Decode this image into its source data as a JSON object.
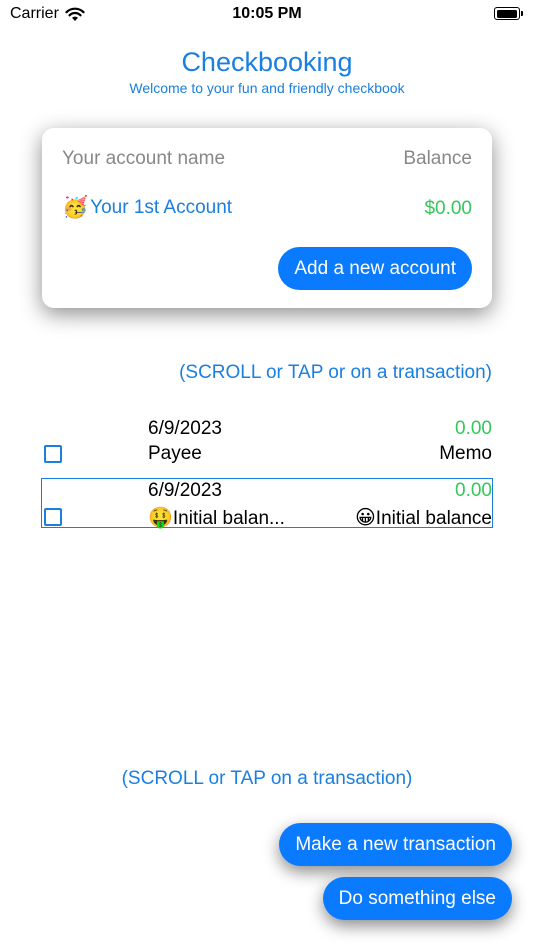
{
  "status_bar": {
    "carrier": "Carrier",
    "time": "10:05 PM",
    "wifi_icon": "wifi-icon",
    "battery_icon": "battery-full-icon"
  },
  "header": {
    "title": "Checkbooking",
    "subtitle": "Welcome to your fun and friendly checkbook"
  },
  "accounts_card": {
    "name_header": "Your account name",
    "balance_header": "Balance",
    "accounts": [
      {
        "emoji": "🥳",
        "name": "Your 1st Account",
        "balance": "$0.00"
      }
    ],
    "add_button_label": "Add a new account"
  },
  "hints": {
    "top": "(SCROLL or TAP or on a transaction)",
    "bottom": "(SCROLL or TAP on a transaction)"
  },
  "transactions": [
    {
      "date": "6/9/2023",
      "amount": "0.00",
      "payee": "Payee",
      "payee_emoji": "",
      "memo": "Memo",
      "memo_emoji": "",
      "selected": false
    },
    {
      "date": "6/9/2023",
      "amount": "0.00",
      "payee": "Initial balan...",
      "payee_emoji": "🤑",
      "memo": "Initial balance",
      "memo_emoji": "😀",
      "selected": true
    }
  ],
  "actions": {
    "new_transaction_label": "Make a new transaction",
    "something_else_label": "Do something else"
  },
  "colors": {
    "accent": "#0a7aff",
    "link_blue": "#1a7fe0",
    "positive_green": "#34c759"
  }
}
